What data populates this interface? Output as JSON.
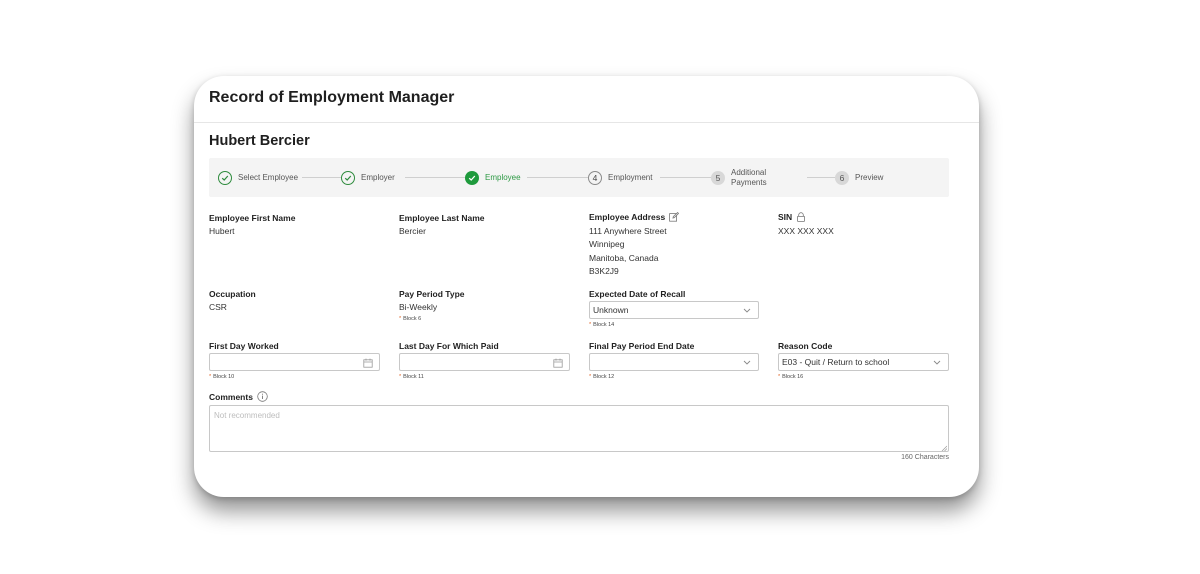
{
  "app": {
    "title": "Record of Employment Manager"
  },
  "employee": {
    "name": "Hubert Bercier"
  },
  "stepper": {
    "steps": [
      {
        "label": "Select Employee",
        "state": "done"
      },
      {
        "label": "Employer",
        "state": "done"
      },
      {
        "label": "Employee",
        "state": "current"
      },
      {
        "label": "Employment",
        "state": "upcoming",
        "number": "4"
      },
      {
        "label_line1": "Additional",
        "label_line2": "Payments",
        "state": "upcoming",
        "number": "5"
      },
      {
        "label": "Preview",
        "state": "upcoming",
        "number": "6"
      }
    ]
  },
  "fields": {
    "first_name": {
      "label": "Employee First Name",
      "value": "Hubert"
    },
    "last_name": {
      "label": "Employee Last Name",
      "value": "Bercier"
    },
    "address": {
      "label": "Employee Address",
      "line1": "111 Anywhere Street",
      "line2": "Winnipeg",
      "line3": "Manitoba, Canada",
      "line4": "B3K2J9",
      "icon": "edit-icon"
    },
    "sin": {
      "label": "SIN",
      "value": "XXX XXX XXX",
      "icon": "lock-icon"
    },
    "occupation": {
      "label": "Occupation",
      "value": "CSR"
    },
    "pay_period_type": {
      "label": "Pay Period Type",
      "value": "Bi-Weekly",
      "hint": "Block 6"
    },
    "expected_recall": {
      "label": "Expected Date of Recall",
      "value": "Unknown",
      "hint": "Block 14"
    },
    "first_day_worked": {
      "label": "First Day Worked",
      "value": "",
      "hint": "Block 10"
    },
    "last_day_paid": {
      "label": "Last Day For Which Paid",
      "value": "",
      "hint": "Block 11"
    },
    "final_pay_period": {
      "label": "Final Pay Period End Date",
      "value": "",
      "hint": "Block 12"
    },
    "reason_code": {
      "label": "Reason Code",
      "value": "E03 - Quit / Return to school",
      "hint": "Block 16"
    },
    "comments": {
      "label": "Comments",
      "placeholder": "Not recommended",
      "char_count": "160 Characters",
      "icon": "info-icon"
    }
  },
  "colors": {
    "accent_green": "#1e9a3c",
    "required_star": "#e06020"
  },
  "required_mark": "*"
}
